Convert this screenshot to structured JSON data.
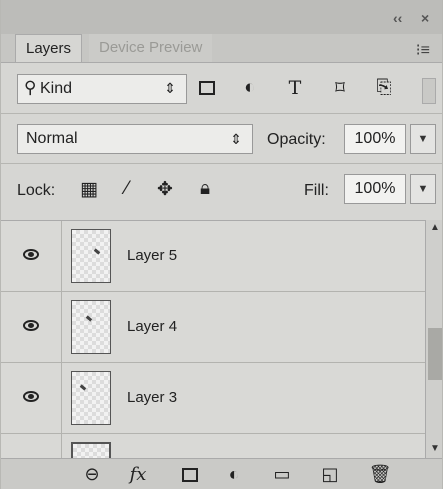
{
  "panel": {
    "title_controls": {
      "collapse": "‹‹",
      "close": "×"
    },
    "tabs": [
      {
        "label": "Layers",
        "active": true
      },
      {
        "label": "Device Preview",
        "active": false
      }
    ],
    "menu_icon": "panel-menu-icon"
  },
  "filter": {
    "kind_label": "Kind",
    "filter_icons": [
      "image-filter-icon",
      "adjustment-filter-icon",
      "type-filter-icon",
      "shape-filter-icon",
      "smart-object-filter-icon"
    ],
    "type_glyph": "T"
  },
  "blend": {
    "mode": "Normal",
    "opacity_label": "Opacity:",
    "opacity_value": "100%"
  },
  "lock": {
    "label": "Lock:",
    "icons": [
      "lock-transparent-pixels-icon",
      "lock-image-pixels-icon",
      "lock-position-icon",
      "lock-all-icon"
    ],
    "fill_label": "Fill:",
    "fill_value": "100%"
  },
  "layers": [
    {
      "name": "Layer 5",
      "visible": true
    },
    {
      "name": "Layer 4",
      "visible": true
    },
    {
      "name": "Layer 3",
      "visible": true
    }
  ],
  "footer_icons": [
    "link-layers-icon",
    "fx-icon",
    "add-mask-icon",
    "adjustment-layer-icon",
    "new-group-icon",
    "new-layer-icon",
    "delete-layer-icon"
  ],
  "footer_fx": "fx"
}
